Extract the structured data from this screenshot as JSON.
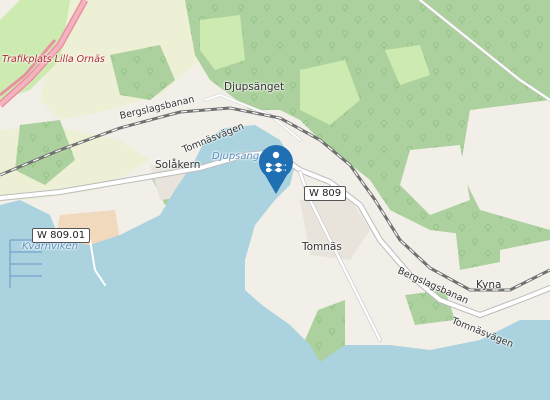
{
  "map": {
    "labels": {
      "trafikplats": "Trafikplats Lilla Ornäs",
      "djupsanget": "Djupsänget",
      "djupsanget_water": "Djupsänge",
      "bergslagsbanan_w": "Bergslagsbanan",
      "tomnasvagen_w": "Tomnäsvägen",
      "solakern": "Solåkern",
      "kvarnviken": "Kvarnviken",
      "tomnas": "Tomnäs",
      "bergslagsbanan_e": "Bergslagsbanan",
      "kyna": "Kyna",
      "tomnasvagen_e": "Tomnäsvägen"
    },
    "shields": {
      "w809": "W 809",
      "w80901": "W 809.01"
    },
    "marker": {
      "icon": "swimming-water-icon",
      "color": "#1f6fb2"
    },
    "colors": {
      "water": "#aad3df",
      "forest": "#add19e",
      "meadow": "#cdebb0",
      "farmland": "#eef0d5",
      "residential": "#e0dfdf",
      "industrial": "#ebdbe8",
      "road": "#ffffff",
      "rail": "#707070"
    }
  }
}
